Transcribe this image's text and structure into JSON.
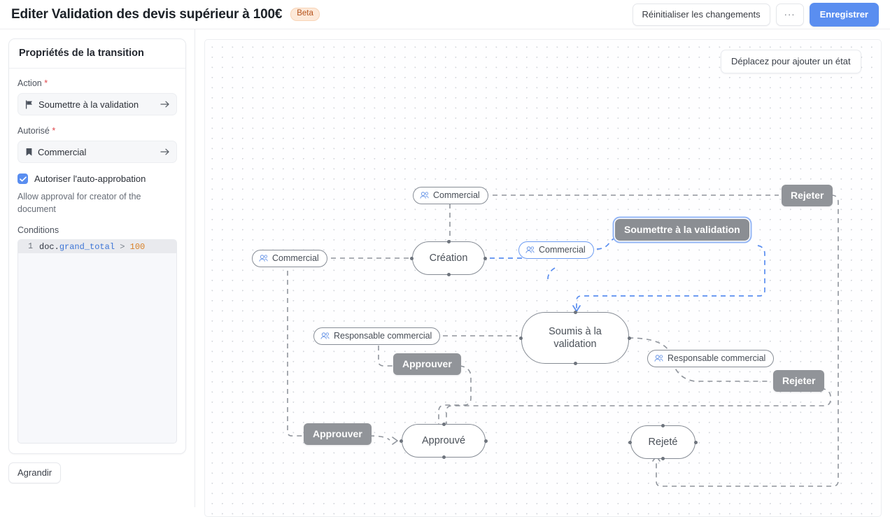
{
  "header": {
    "title": "Editer Validation des devis supérieur à 100€",
    "badge": "Beta",
    "reset_label": "Réinitialiser les changements",
    "more_label": "···",
    "save_label": "Enregistrer"
  },
  "sidebar": {
    "panel_title": "Propriétés de la transition",
    "action": {
      "label": "Action",
      "required": "*",
      "value": "Soumettre à la validation",
      "icon": "flag-icon",
      "arrow": "arrow-right-icon"
    },
    "authorized": {
      "label": "Autorisé",
      "required": "*",
      "value": "Commercial",
      "icon": "bookmark-icon",
      "arrow": "arrow-right-icon"
    },
    "self_approval": {
      "checked": true,
      "label": "Autoriser l'auto-approbation",
      "help": "Allow approval for creator of the document"
    },
    "conditions": {
      "label": "Conditions",
      "line_number": "1",
      "code": {
        "object": "doc.",
        "property": "grand_total",
        "operator": " > ",
        "number": "100"
      }
    },
    "expand_label": "Agrandir"
  },
  "canvas": {
    "hint": "Déplacez pour ajouter un état",
    "states": [
      {
        "id": "creation",
        "label": "Création"
      },
      {
        "id": "soumis",
        "label": "Soumis à la validation"
      },
      {
        "id": "approuve",
        "label": "Approuvé"
      },
      {
        "id": "rejete",
        "label": "Rejeté"
      }
    ],
    "actions": [
      {
        "id": "rejeter-top",
        "label": "Rejeter",
        "selected": false
      },
      {
        "id": "soumettre",
        "label": "Soumettre à la validation",
        "selected": true
      },
      {
        "id": "approuver-mid",
        "label": "Approuver",
        "selected": false
      },
      {
        "id": "rejeter-mid",
        "label": "Rejeter",
        "selected": false
      },
      {
        "id": "approuver-bottom",
        "label": "Approuver",
        "selected": false
      }
    ],
    "roles": [
      {
        "id": "commercial-top",
        "label": "Commercial",
        "selected": false
      },
      {
        "id": "commercial-left",
        "label": "Commercial",
        "selected": false
      },
      {
        "id": "commercial-right",
        "label": "Commercial",
        "selected": true
      },
      {
        "id": "resp-left",
        "label": "Responsable commercial",
        "selected": false
      },
      {
        "id": "resp-right",
        "label": "Responsable commercial",
        "selected": false
      }
    ]
  },
  "colors": {
    "accent": "#5a8ef0",
    "selection": "#93b5f5",
    "action_bg": "#919499",
    "badge_bg": "#fde9d9",
    "badge_fg": "#b5521b"
  }
}
